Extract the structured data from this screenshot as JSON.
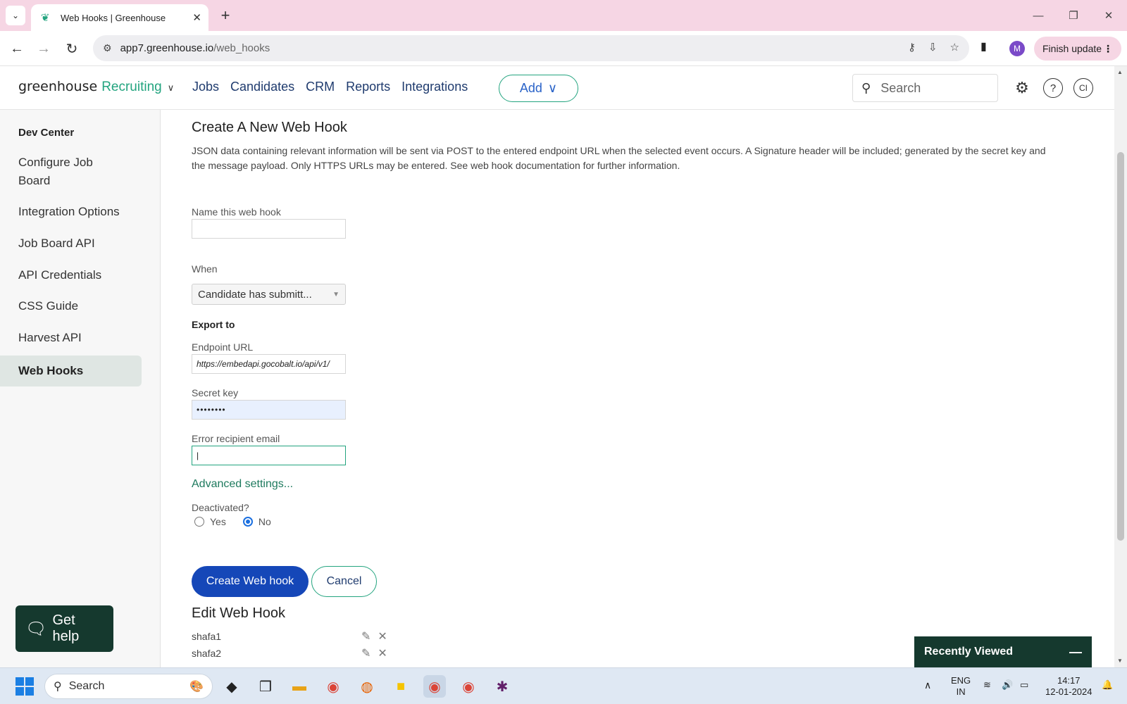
{
  "browser": {
    "tab_title": "Web Hooks | Greenhouse",
    "url_host": "app7.greenhouse.io",
    "url_path": "/web_hooks",
    "finish_update_label": "Finish update",
    "profile_initial": "M"
  },
  "header": {
    "logo_text": "greenhouse",
    "logo_product": "Recruiting",
    "nav": [
      "Jobs",
      "Candidates",
      "CRM",
      "Reports",
      "Integrations"
    ],
    "add_label": "Add",
    "search_placeholder": "Search",
    "avatar_initials": "CI"
  },
  "sidebar": {
    "heading": "Dev Center",
    "items": [
      {
        "label": "Configure Job Board",
        "active": false
      },
      {
        "label": "Integration Options",
        "active": false
      },
      {
        "label": "Job Board API",
        "active": false
      },
      {
        "label": "API Credentials",
        "active": false
      },
      {
        "label": "CSS Guide",
        "active": false
      },
      {
        "label": "Harvest API",
        "active": false
      },
      {
        "label": "Web Hooks",
        "active": true
      }
    ]
  },
  "form": {
    "title": "Create A New Web Hook",
    "description": "JSON data containing relevant information will be sent via POST to the entered endpoint URL when the selected event occurs. A Signature header will be included; generated by the secret key and the message payload. Only HTTPS URLs may be entered. See web hook documentation for further information.",
    "name_label": "Name this web hook",
    "name_value": "",
    "when_label": "When",
    "when_value": "Candidate has submitt...",
    "export_label": "Export to",
    "endpoint_label": "Endpoint URL",
    "endpoint_value": "https://embedapi.gocobalt.io/api/v1/",
    "secret_label": "Secret key",
    "secret_value": "••••••••",
    "error_email_label": "Error recipient email",
    "error_email_value": "|",
    "advanced_label": "Advanced settings...",
    "deactivated_label": "Deactivated?",
    "yes_label": "Yes",
    "no_label": "No",
    "deactivated_selected": "No",
    "create_label": "Create Web hook",
    "cancel_label": "Cancel"
  },
  "edit": {
    "title": "Edit Web Hook",
    "hooks": [
      "shafa1",
      "shafa2"
    ]
  },
  "widgets": {
    "get_help_label": "Get help",
    "recently_viewed_label": "Recently Viewed"
  },
  "taskbar": {
    "search_label": "Search",
    "lang_top": "ENG",
    "lang_bottom": "IN",
    "time": "14:17",
    "date": "12-01-2024"
  },
  "colors": {
    "brand_green": "#23a47f",
    "primary_blue": "#1547b8",
    "widget_dark": "#15392e"
  }
}
